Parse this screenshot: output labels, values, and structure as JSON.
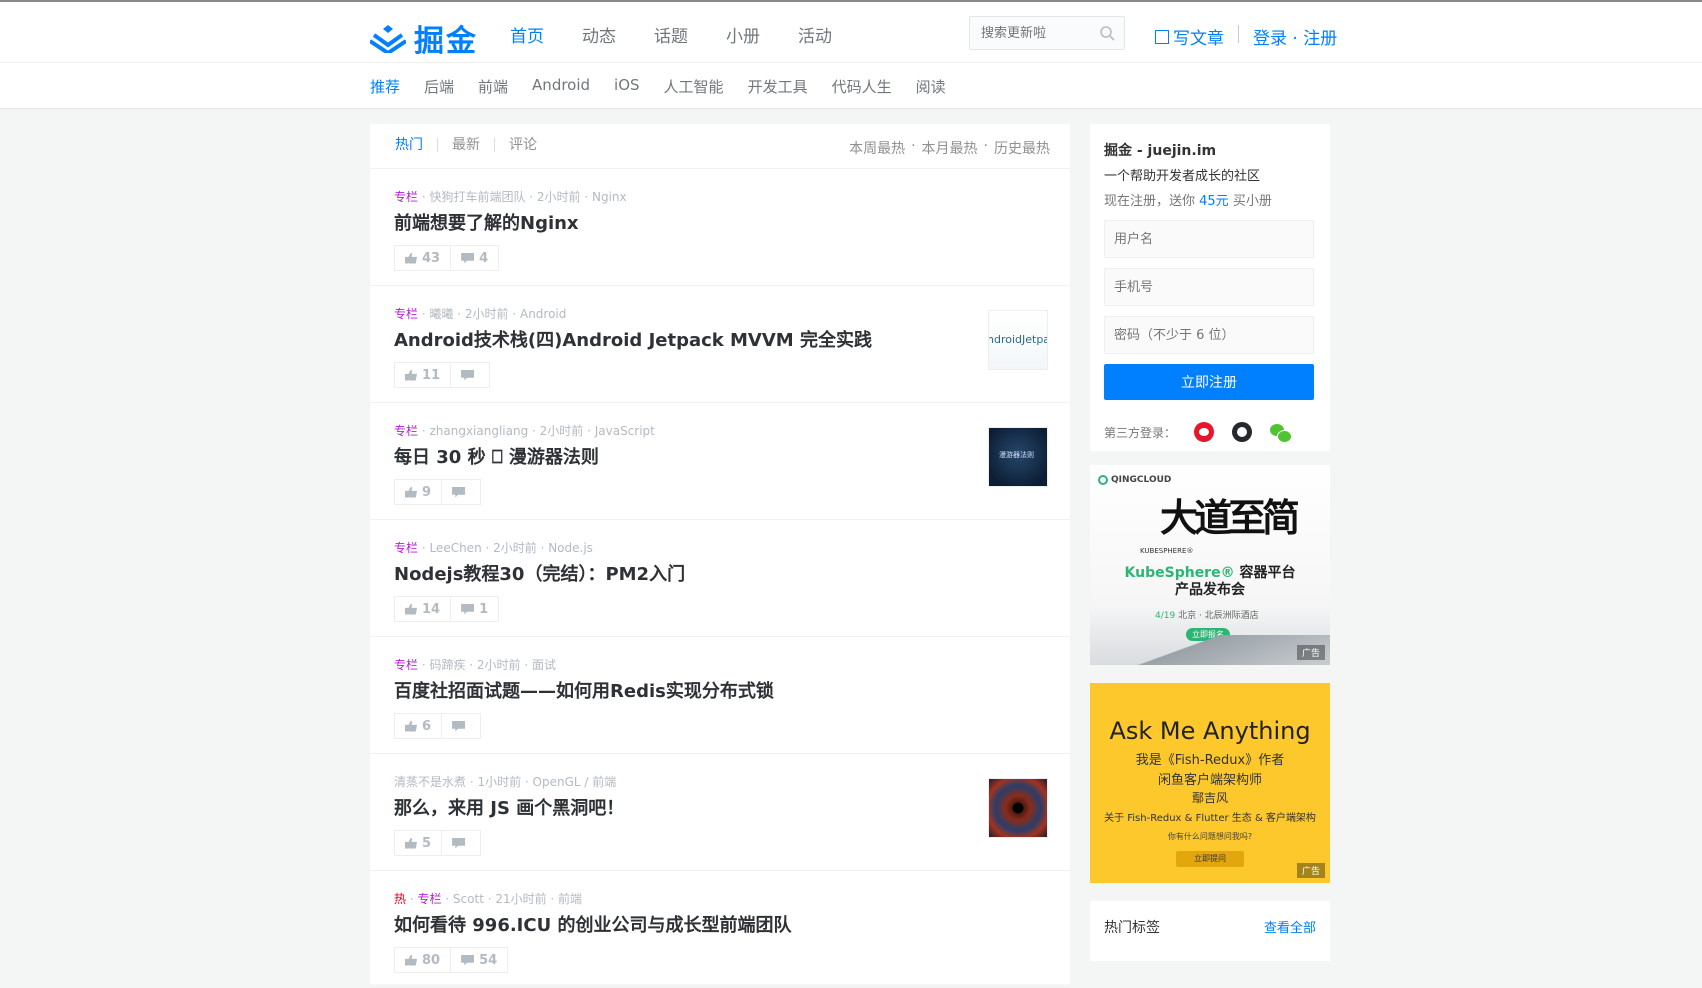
{
  "header": {
    "logo_text": "掘金",
    "nav": [
      "首页",
      "动态",
      "话题",
      "小册",
      "活动"
    ],
    "search_placeholder": "搜索更新啦",
    "write_label": "写文章",
    "auth_label": "登录 · 注册",
    "accent_color": "#007fff"
  },
  "subnav": [
    "推荐",
    "后端",
    "前端",
    "Android",
    "iOS",
    "人工智能",
    "开发工具",
    "代码人生",
    "阅读"
  ],
  "feed": {
    "tabs": [
      "热门",
      "最新",
      "评论"
    ],
    "sorts": [
      "本周最热",
      "·",
      "本月最热",
      "·",
      "历史最热"
    ],
    "entries": [
      {
        "tag": "专栏",
        "meta": " · 快狗打车前端团队 · 2小时前 · Nginx",
        "title": "前端想要了解的Nginx",
        "likes": "43",
        "comments": "4"
      },
      {
        "tag": "专栏",
        "meta": " · 曦曦 · 2小时前 · Android",
        "title": "Android技术栈(四)Android Jetpack MVVM 完全实践",
        "likes": "11",
        "comments": "",
        "thumb_text": "ndroidJetpac"
      },
      {
        "tag": "专栏",
        "meta": " · zhangxiangliang · 2小时前 · JavaScript",
        "title": "每日 30 秒 ⎕ 漫游器法则",
        "likes": "9",
        "comments": "",
        "thumb_text": "漫游器法则"
      },
      {
        "tag": "专栏",
        "meta": " · LeeChen · 2小时前 · Node.js",
        "title": "Nodejs教程30（完结）：PM2入门",
        "likes": "14",
        "comments": "1"
      },
      {
        "tag": "专栏",
        "meta": " · 码蹄疾 · 2小时前 · 面试",
        "title": "百度社招面试题——如何用Redis实现分布式锁",
        "likes": "6",
        "comments": ""
      },
      {
        "tag": "",
        "meta": "清蒸不是水煮 · 1小时前 · OpenGL / 前端",
        "title": "那么，来用 JS 画个黑洞吧！",
        "likes": "5",
        "comments": ""
      },
      {
        "hot": "热",
        "tag": "专栏",
        "meta": " · Scott · 21小时前 · 前端",
        "title": "如何看待 996.ICU 的创业公司与成长型前端团队",
        "likes": "80",
        "comments": "54"
      }
    ]
  },
  "sidebar": {
    "site": "掘金 - juejin.im",
    "slogan": "一个帮助开发者成长的社区",
    "promo_prefix": "现在注册，送你 ",
    "promo_money": "45元",
    "promo_suffix": " 买小册",
    "username_placeholder": "用户名",
    "phone_placeholder": "手机号",
    "password_placeholder": "密码（不少于 6 位）",
    "submit_label": "立即注册",
    "oauth_label": "第三方登录：",
    "ad1": {
      "brand": "QINGCLOUD",
      "calligraphy": "大道至简",
      "kubesphere": "KUBESPHERE®",
      "headline_brand": "KubeSphere®",
      "headline_rest": " 容器平台",
      "headline_line2": "产品发布会",
      "date": "4/19",
      "venue": " 北京 · 北辰洲际酒店",
      "cta": "立即报名",
      "badge": "广告"
    },
    "ad2": {
      "title": "Ask Me Anything",
      "line1": "我是《Fish-Redux》作者",
      "line2": "闲鱼客户端架构师",
      "line3": "鄢吉风",
      "line4": "关于 Fish-Redux & Flutter 生态 & 客户端架构",
      "small": "你有什么问题想问我吗?",
      "cta": "立即提问",
      "badge": "广告"
    },
    "tags_title": "热门标签",
    "tags_all": "查看全部"
  }
}
